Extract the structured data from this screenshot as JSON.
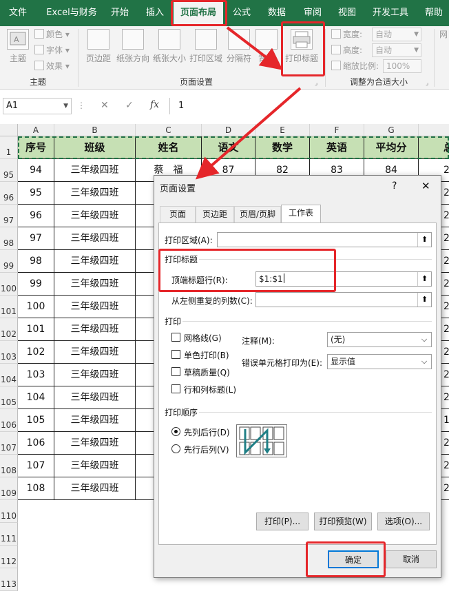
{
  "ribbon_tabs": [
    "文件",
    "Excel与财务",
    "开始",
    "插入",
    "页面布局",
    "公式",
    "数据",
    "审阅",
    "视图",
    "开发工具",
    "帮助"
  ],
  "active_tab": "页面布局",
  "ribbon": {
    "theme_btn": "主题",
    "colors": "颜色",
    "fonts": "字体",
    "effects": "效果",
    "group_theme": "主题",
    "margins": "页边距",
    "orientation": "纸张方向",
    "size": "纸张大小",
    "print_area": "打印区域",
    "breaks": "分隔符",
    "background": "背景",
    "print_titles": "打印标题",
    "group_page_setup": "页面设置",
    "width_label": "宽度:",
    "height_label": "高度:",
    "scale_label": "缩放比例:",
    "width_value": "自动",
    "height_value": "自动",
    "scale_value": "100%",
    "group_scale": "调整为合适大小",
    "gridlines_fragment": "网"
  },
  "formula_bar": {
    "name_box": "A1",
    "fx": "fx",
    "cancel": "✕",
    "enter": "✓",
    "value": "1"
  },
  "columns": [
    "A",
    "B",
    "C",
    "D",
    "E",
    "F",
    "G"
  ],
  "header_row_num": "1",
  "header": [
    "序号",
    "班级",
    "姓名",
    "语文",
    "数学",
    "英语",
    "平均分",
    "总"
  ],
  "first_row": {
    "rownum": "95",
    "cells": [
      "94",
      "三年级四班",
      "蔡　福",
      "87",
      "82",
      "83",
      "84",
      "2"
    ]
  },
  "rows": [
    {
      "rownum": "96",
      "seq": "95",
      "cls": "三年级四班",
      "tail": "2"
    },
    {
      "rownum": "97",
      "seq": "96",
      "cls": "三年级四班",
      "tail": "2"
    },
    {
      "rownum": "98",
      "seq": "97",
      "cls": "三年级四班",
      "tail": "2"
    },
    {
      "rownum": "99",
      "seq": "98",
      "cls": "三年级四班",
      "tail": "2"
    },
    {
      "rownum": "100",
      "seq": "99",
      "cls": "三年级四班",
      "tail": "2"
    },
    {
      "rownum": "101",
      "seq": "100",
      "cls": "三年级四班",
      "tail": "2"
    },
    {
      "rownum": "102",
      "seq": "101",
      "cls": "三年级四班",
      "tail": "2"
    },
    {
      "rownum": "103",
      "seq": "102",
      "cls": "三年级四班",
      "tail": "2"
    },
    {
      "rownum": "104",
      "seq": "103",
      "cls": "三年级四班",
      "tail": "2"
    },
    {
      "rownum": "105",
      "seq": "104",
      "cls": "三年级四班",
      "tail": "2"
    },
    {
      "rownum": "106",
      "seq": "105",
      "cls": "三年级四班",
      "tail": "1"
    },
    {
      "rownum": "107",
      "seq": "106",
      "cls": "三年级四班",
      "tail": "2"
    },
    {
      "rownum": "108",
      "seq": "107",
      "cls": "三年级四班",
      "tail": "2"
    },
    {
      "rownum": "109",
      "seq": "108",
      "cls": "三年级四班",
      "tail": "2"
    }
  ],
  "empty_rows": [
    "110",
    "111",
    "112",
    "113"
  ],
  "dialog": {
    "title": "页面设置",
    "help": "?",
    "close": "✕",
    "tabs": [
      "页面",
      "页边距",
      "页眉/页脚",
      "工作表"
    ],
    "print_area_label": "打印区域(A):",
    "print_titles_section": "打印标题",
    "rows_repeat_label": "顶端标题行(R):",
    "rows_repeat_value": "$1:$1",
    "cols_repeat_label": "从左侧重复的列数(C):",
    "print_section": "打印",
    "gridlines": "网格线(G)",
    "bw": "单色打印(B)",
    "draft": "草稿质量(Q)",
    "rowcol_headings": "行和列标题(L)",
    "comments_label": "注释(M):",
    "comments_value": "(无)",
    "errors_label": "错误单元格打印为(E):",
    "errors_value": "显示值",
    "order_section": "打印顺序",
    "down_then_over": "先列后行(D)",
    "over_then_down": "先行后列(V)",
    "print_btn": "打印(P)...",
    "preview_btn": "打印预览(W)",
    "options_btn": "选项(O)...",
    "ok": "确定",
    "cancel": "取消"
  },
  "colors": {
    "excel_green": "#217346",
    "header_fill": "#c6e0b4",
    "annotation_red": "#e5262a"
  }
}
